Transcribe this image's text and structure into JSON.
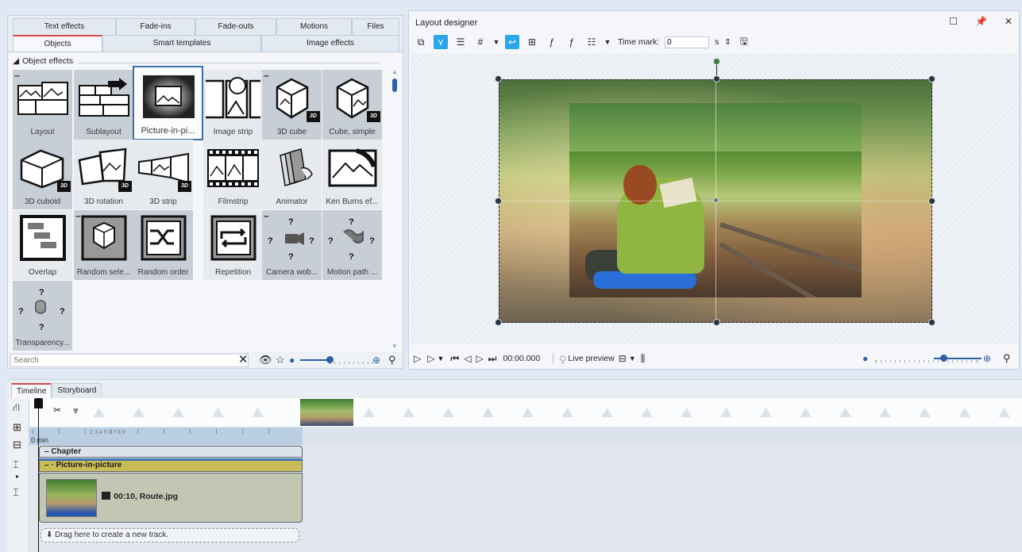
{
  "effects_panel": {
    "tabs_row1": [
      "Text effects",
      "Fade-ins",
      "Fade-outs",
      "Motions",
      "Files"
    ],
    "tabs_row2": [
      "Objects",
      "Smart templates",
      "Image effects"
    ],
    "active_tab": "Objects",
    "section_title": "Object effects",
    "tiles": [
      {
        "label": "Layout",
        "icon": "layout-icon"
      },
      {
        "label": "Sublayout",
        "icon": "sublayout-icon"
      },
      {
        "label": "Picture-in-pi...",
        "icon": "picture-in-picture-icon"
      },
      {
        "label": "Image strip",
        "icon": "image-strip-icon"
      },
      {
        "label": "3D cube",
        "icon": "3d-cube-icon"
      },
      {
        "label": "Cube, simple",
        "icon": "cube-simple-icon"
      },
      {
        "label": "3D cuboid",
        "icon": "3d-cuboid-icon"
      },
      {
        "label": "3D rotation",
        "icon": "3d-rotation-icon"
      },
      {
        "label": "3D strip",
        "icon": "3d-strip-icon"
      },
      {
        "label": "Filmstrip",
        "icon": "filmstrip-icon"
      },
      {
        "label": "Animator",
        "icon": "animator-icon"
      },
      {
        "label": "Ken Burns ef...",
        "icon": "ken-burns-icon"
      },
      {
        "label": "Overlap",
        "icon": "overlap-icon"
      },
      {
        "label": "Random sele...",
        "icon": "random-selection-icon"
      },
      {
        "label": "Random order",
        "icon": "random-order-icon"
      },
      {
        "label": "Repetition",
        "icon": "repetition-icon"
      },
      {
        "label": "Camera wob...",
        "icon": "camera-wobble-icon"
      },
      {
        "label": "Motion path ...",
        "icon": "motion-path-icon"
      },
      {
        "label": "Transparency...",
        "icon": "transparency-icon"
      }
    ],
    "badge_3d": "3D",
    "search_placeholder": "Search"
  },
  "layout_designer": {
    "title": "Layout designer",
    "time_mark_label": "Time mark:",
    "time_mark_value": "0",
    "time_mark_unit": "s",
    "time_readout": "00:00.000",
    "live_preview_label": "Live preview"
  },
  "timeline": {
    "tabs": [
      "Timeline",
      "Storyboard"
    ],
    "active_tab": "Timeline",
    "ruler_label": "0 min",
    "ruler_numbers": "2  3  4  5  6  7  8  9",
    "chapter_label": "Chapter",
    "pip_label": "Picture-in-picture",
    "image_caption": "00:10, Route.jpg",
    "new_track_label": "Drag here to create a new track."
  },
  "colors": {
    "accent_blue": "#2d5fa3",
    "tab_active_red": "#d24a4a",
    "pip_track_yellow": "#c9bb55",
    "selected_tool_blue": "#2aa7e8"
  }
}
